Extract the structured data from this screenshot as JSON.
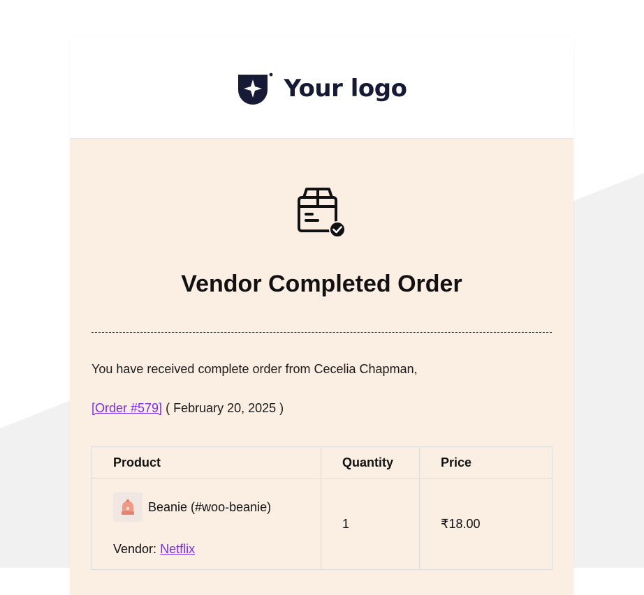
{
  "logo": {
    "text": "Your logo",
    "icon": "shield-star-logo"
  },
  "email": {
    "icon": "box-check-icon",
    "title": "Vendor Completed Order",
    "intro": "You have received complete order from Cecelia Chapman,",
    "order_link": "[Order #579]",
    "order_date": "( February 20, 2025 )"
  },
  "table": {
    "headers": {
      "product": "Product",
      "quantity": "Quantity",
      "price": "Price"
    },
    "rows": [
      {
        "thumb_icon": "beanie-thumbnail",
        "product": "Beanie (#woo-beanie)",
        "vendor_label": "Vendor:",
        "vendor_name": "Netflix",
        "quantity": "1",
        "price": "₹18.00"
      }
    ]
  },
  "colors": {
    "accent_link": "#7b2ff0",
    "body_background": "#fbeee3",
    "logo_navy": "#161a35"
  }
}
